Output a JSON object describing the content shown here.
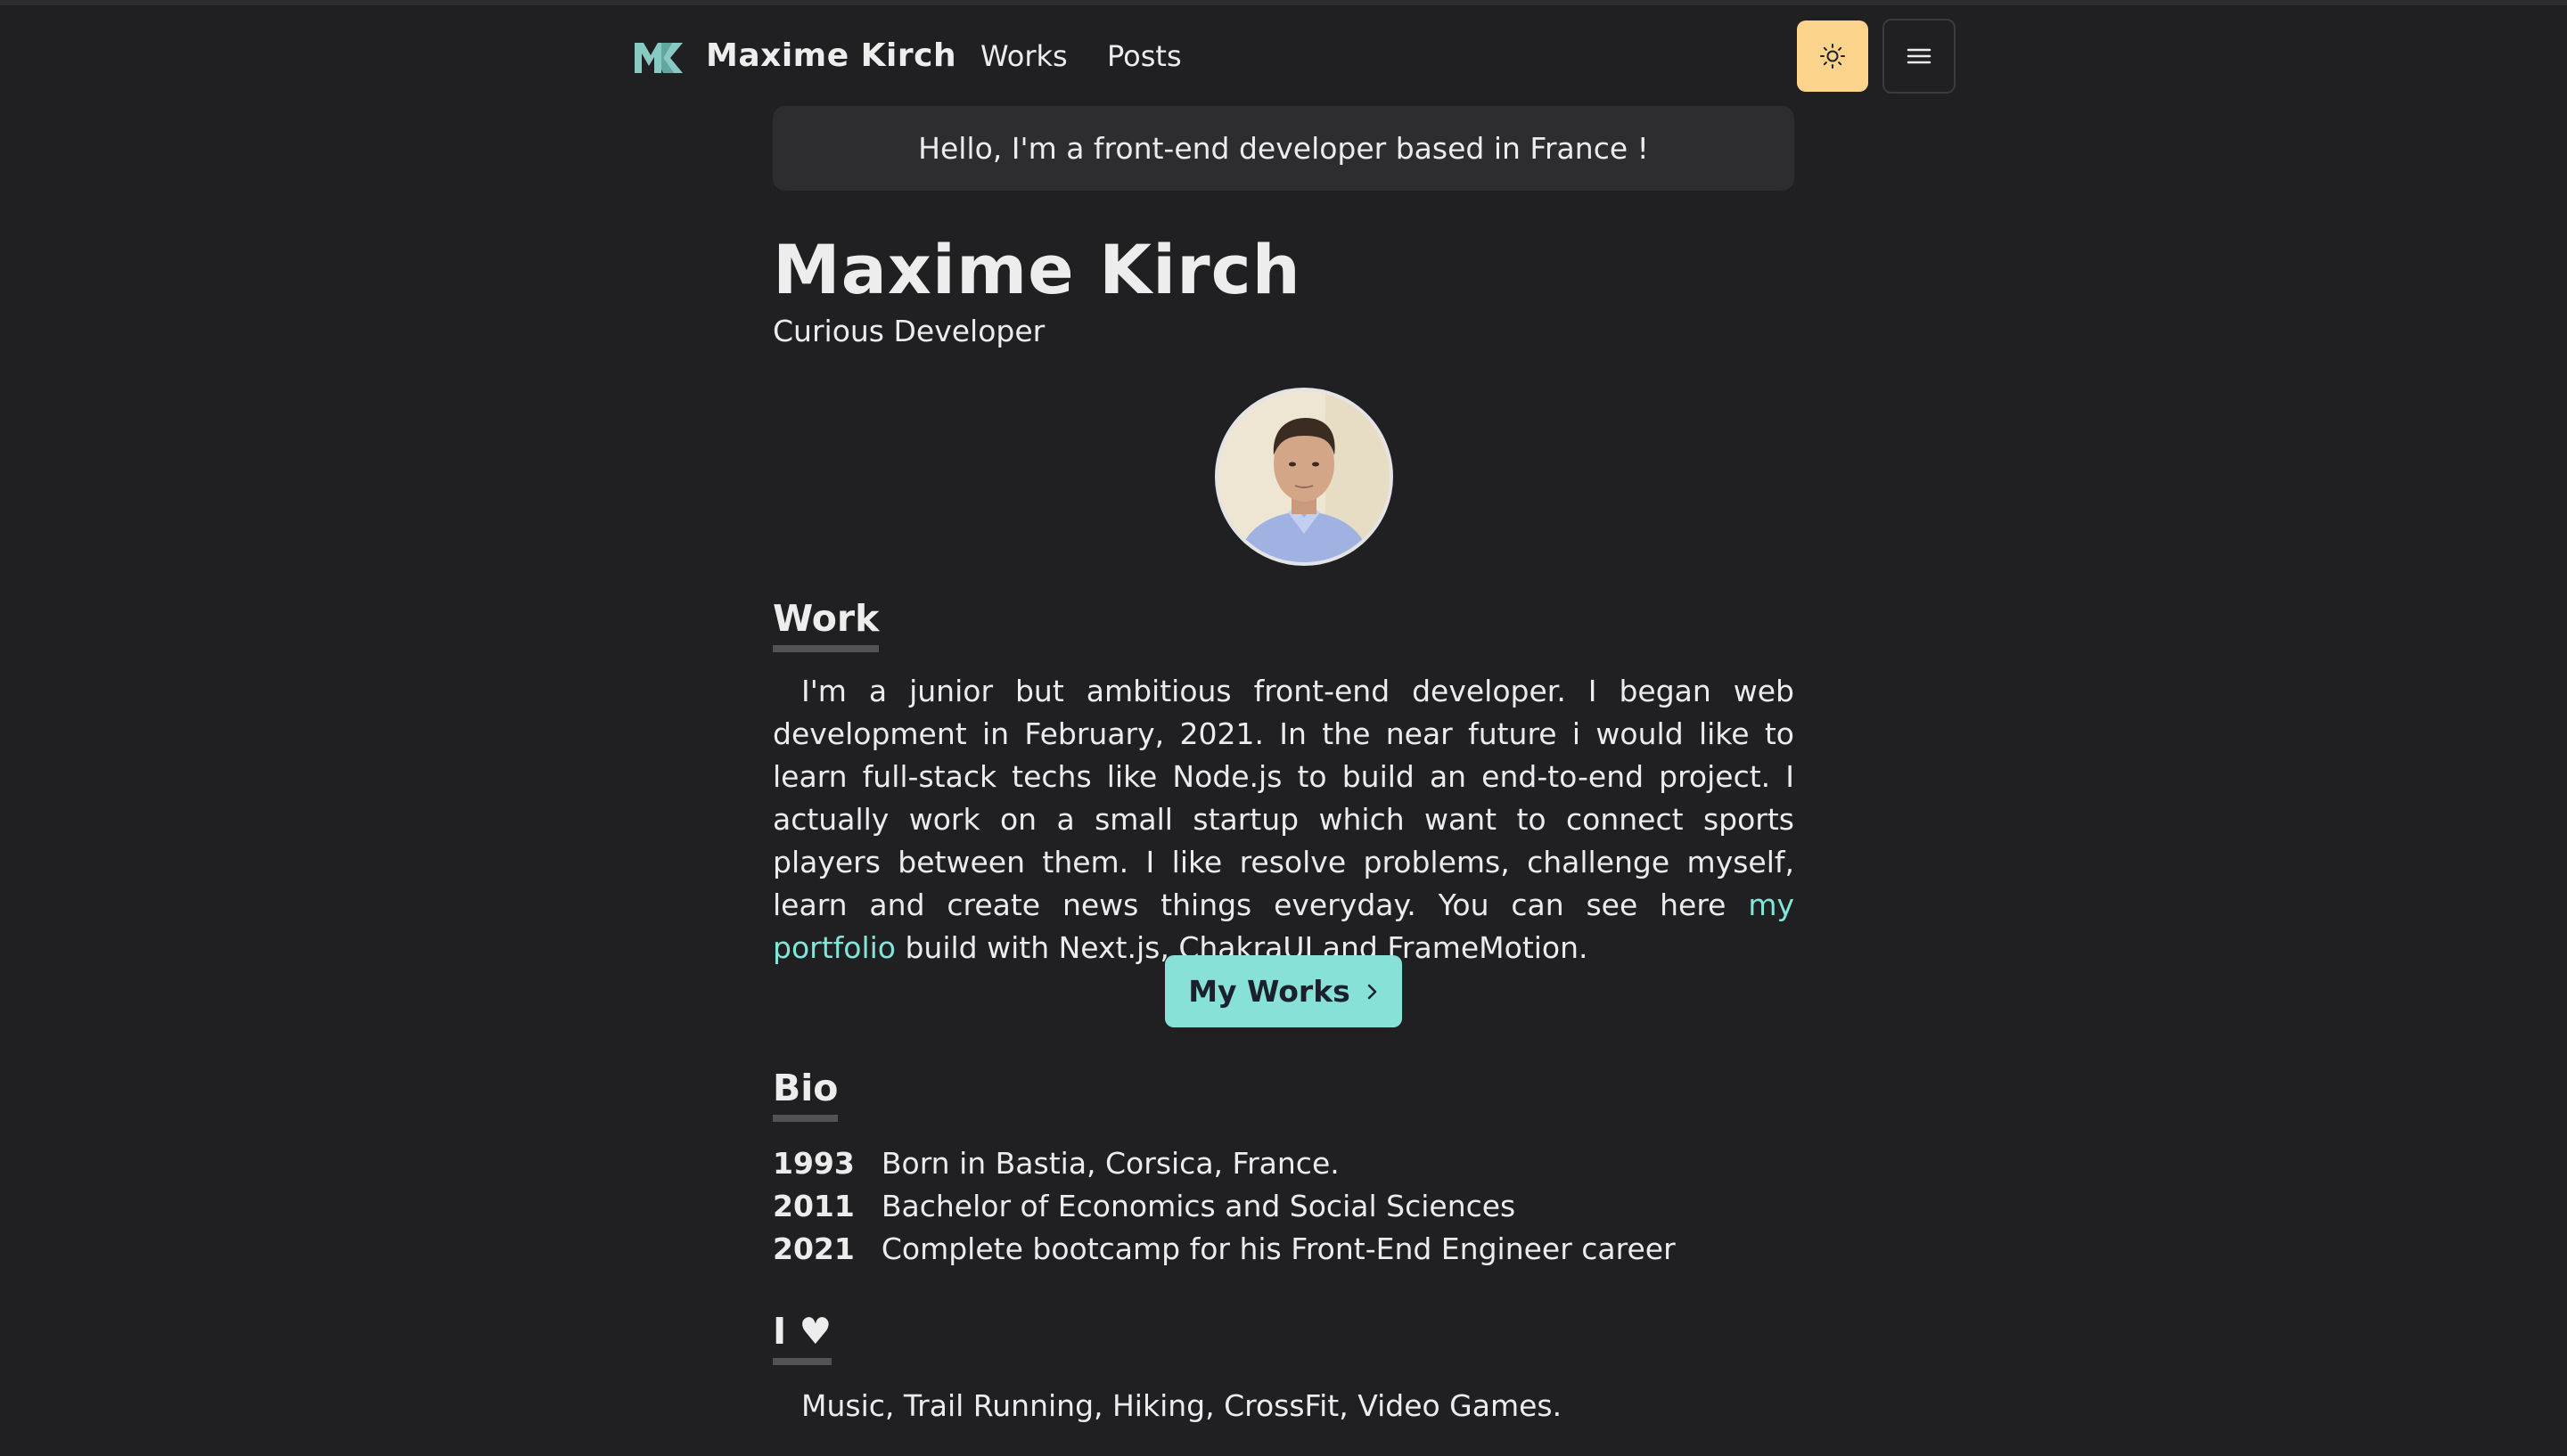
{
  "nav": {
    "brand": "Maxime Kirch",
    "links": [
      {
        "label": "Works"
      },
      {
        "label": "Posts"
      }
    ],
    "theme_icon": "sun-icon",
    "menu_icon": "hamburger-icon"
  },
  "greeting": "Hello, I'm a front-end developer based in France !",
  "profile": {
    "name": "Maxime Kirch",
    "subtitle": "Curious Developer"
  },
  "work": {
    "title": "Work",
    "text_before": "I'm a junior but ambitious front-end developer. I began web development in February, 2021. In the near future i would like to learn full-stack techs like Node.js to build an end-to-end project. I actually work on a small startup which want to connect sports players between them. I like resolve problems, challenge myself, learn and create news things everyday. You can see here ",
    "link_text": "my portfolio",
    "text_after": " build with Next.js, ChakraUI and FrameMotion.",
    "button_label": "My Works"
  },
  "bio": {
    "title": "Bio",
    "entries": [
      {
        "year": "1993",
        "text": "Born in Bastia, Corsica, France."
      },
      {
        "year": "2011",
        "text": "Bachelor of Economics and Social Sciences"
      },
      {
        "year": "2021",
        "text": "Complete bootcamp for his Front-End Engineer career"
      }
    ]
  },
  "love": {
    "title": "I ♥",
    "text": "Music, Trail Running, Hiking, CrossFit, Video Games."
  },
  "colors": {
    "background": "#202023",
    "accent": "#88e1d7",
    "link": "#81e6d9",
    "theme_button": "#fbd38d"
  }
}
